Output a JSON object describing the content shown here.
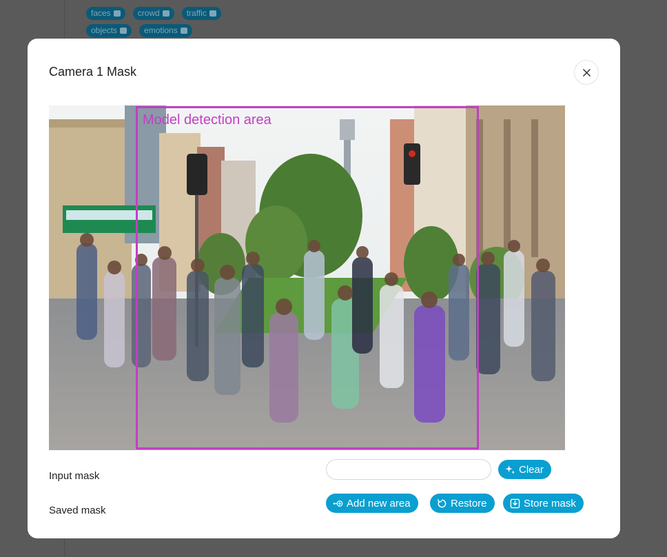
{
  "background": {
    "tags": [
      {
        "label": "faces",
        "icon": "user-icon"
      },
      {
        "label": "crowd",
        "icon": "users-icon"
      },
      {
        "label": "traffic",
        "icon": "car-icon"
      },
      {
        "label": "objects",
        "icon": "document-icon"
      },
      {
        "label": "emotions",
        "icon": "user-check-icon"
      }
    ]
  },
  "modal": {
    "title": "Camera 1 Mask",
    "close_icon": "close-icon"
  },
  "scene": {
    "area_label": "Model detection area",
    "area_color": "#c23fc3"
  },
  "input_mask": {
    "label": "Input mask",
    "value": "",
    "placeholder": "",
    "clear_label": "Clear",
    "clear_icon": "sparkle-icon"
  },
  "saved_mask": {
    "label": "Saved mask",
    "add_label": "Add new area",
    "add_icon": "add-area-icon",
    "restore_label": "Restore",
    "restore_icon": "restore-icon",
    "store_label": "Store mask",
    "store_icon": "save-icon"
  },
  "colors": {
    "accent": "#0a9fd0",
    "overlay": "#555555"
  }
}
